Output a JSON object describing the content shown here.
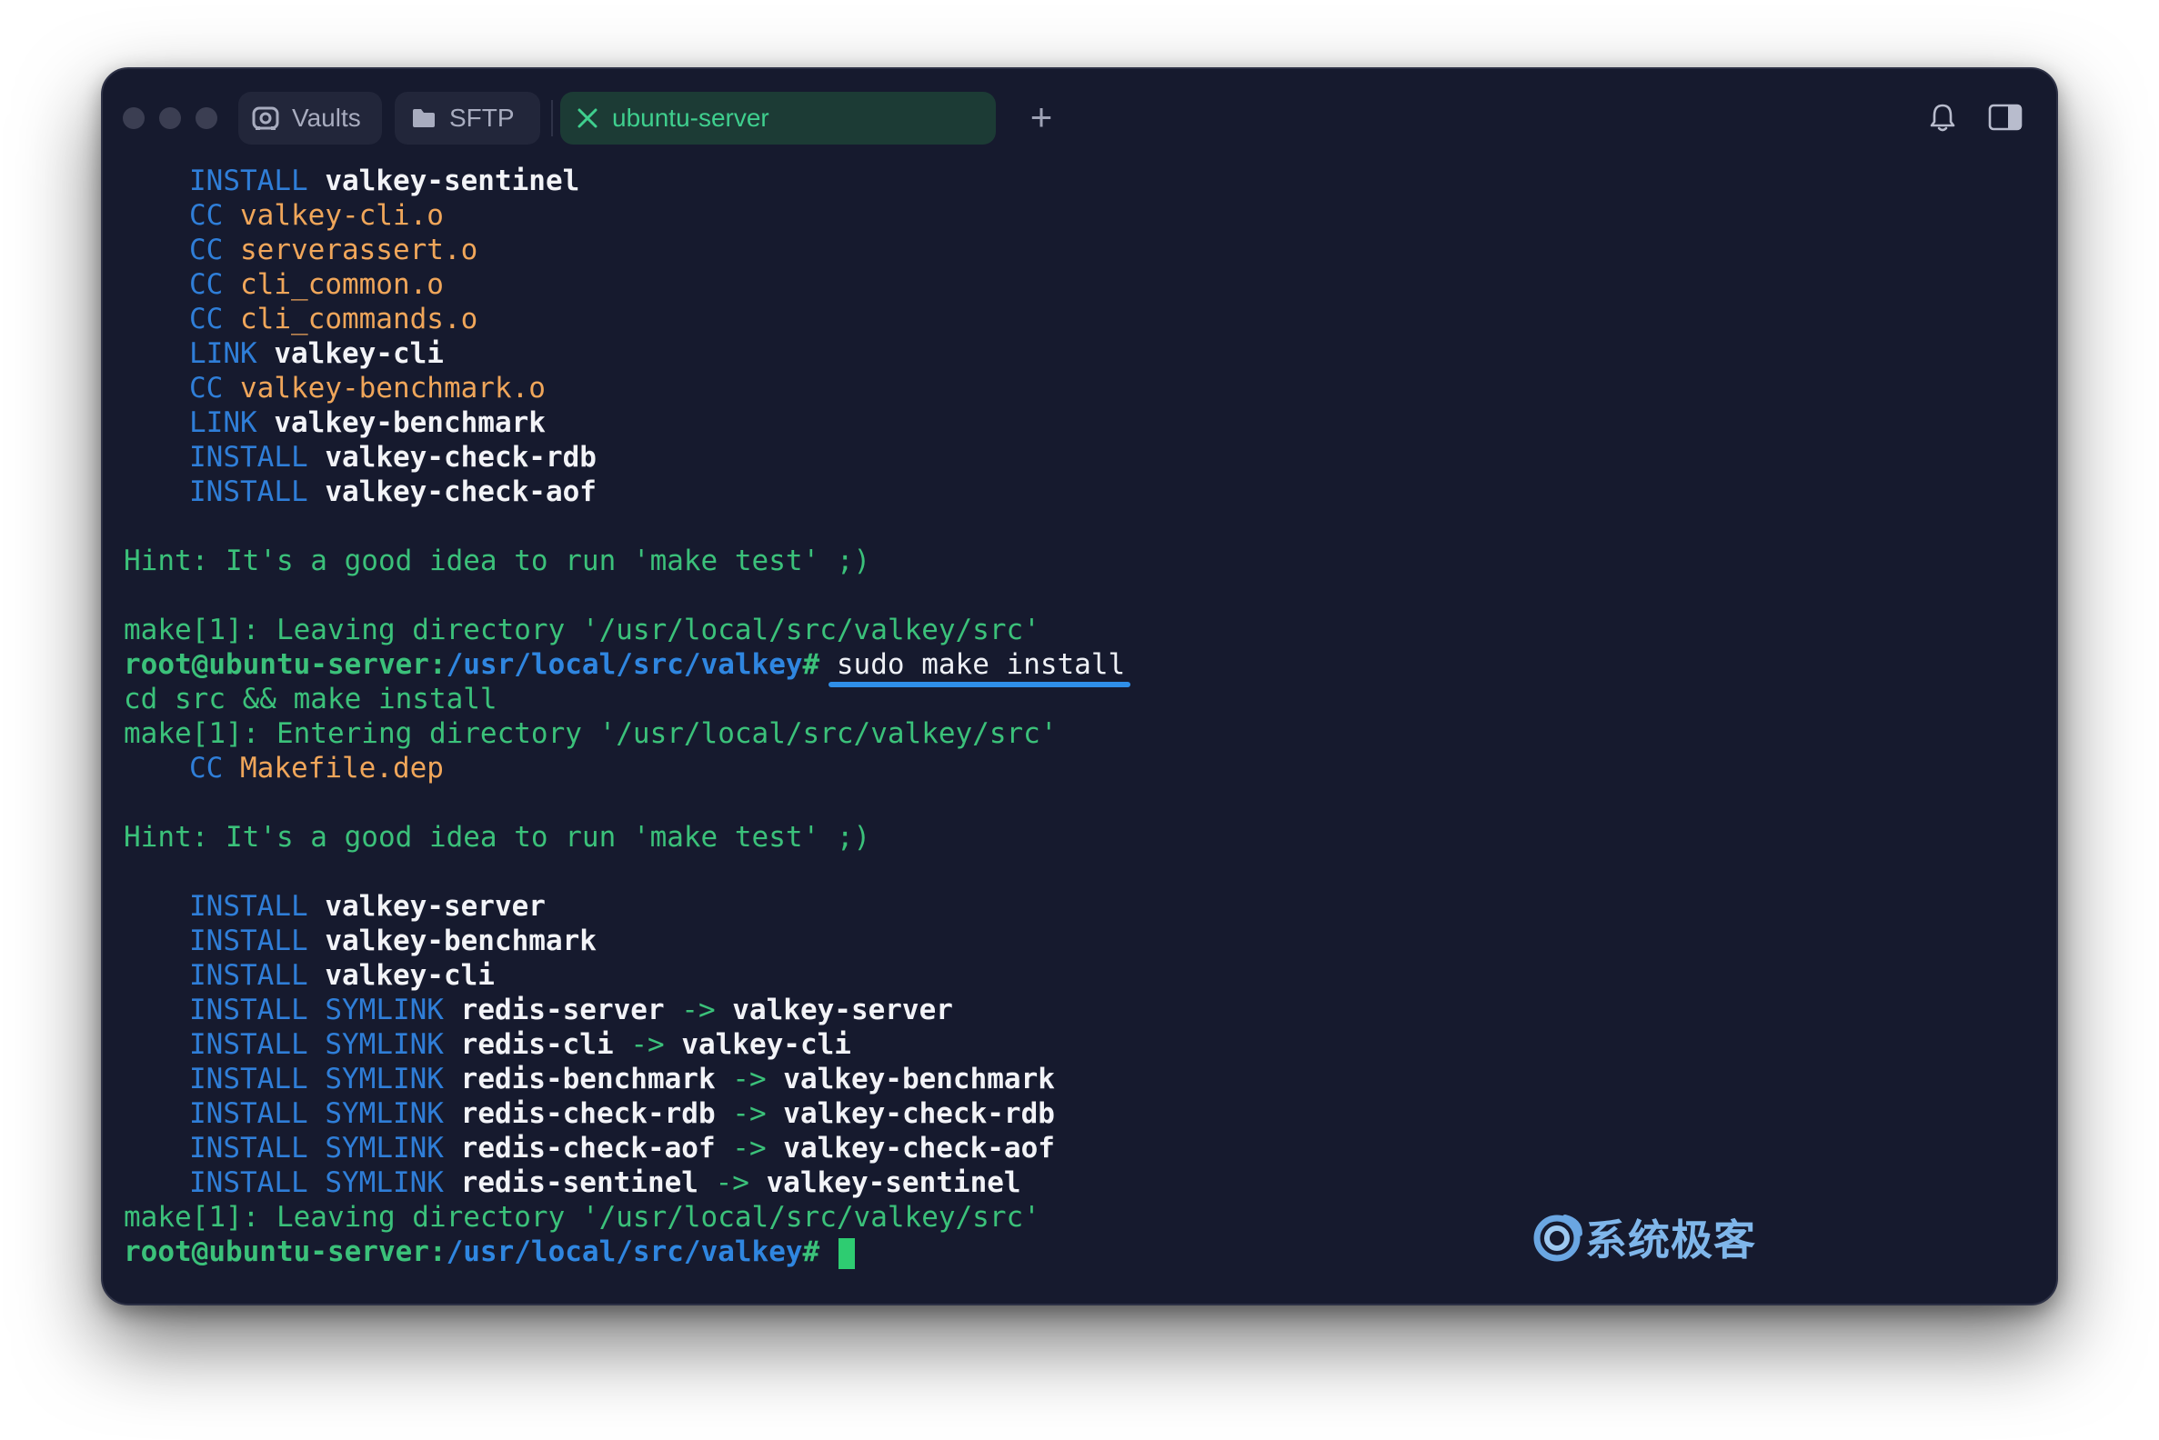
{
  "window": {
    "tabs": [
      {
        "label": "Vaults",
        "icon": "vault-icon",
        "active": false
      },
      {
        "label": "SFTP",
        "icon": "folder-icon",
        "active": false
      },
      {
        "label": "ubuntu-server",
        "icon": "close-icon",
        "active": true
      }
    ],
    "new_tab_label": "+"
  },
  "terminal": {
    "build1": [
      {
        "tag": "INSTALL",
        "name": "valkey-sentinel",
        "kind": "install"
      },
      {
        "tag": "CC",
        "name": "valkey-cli.o",
        "kind": "cc"
      },
      {
        "tag": "CC",
        "name": "serverassert.o",
        "kind": "cc"
      },
      {
        "tag": "CC",
        "name": "cli_common.o",
        "kind": "cc"
      },
      {
        "tag": "CC",
        "name": "cli_commands.o",
        "kind": "cc"
      },
      {
        "tag": "LINK",
        "name": "valkey-cli",
        "kind": "link"
      },
      {
        "tag": "CC",
        "name": "valkey-benchmark.o",
        "kind": "cc"
      },
      {
        "tag": "LINK",
        "name": "valkey-benchmark",
        "kind": "link"
      },
      {
        "tag": "INSTALL",
        "name": "valkey-check-rdb",
        "kind": "install"
      },
      {
        "tag": "INSTALL",
        "name": "valkey-check-aof",
        "kind": "install"
      }
    ],
    "hint": "Hint: It's a good idea to run 'make test' ;)",
    "leaving": "make[1]: Leaving directory '/usr/local/src/valkey/src'",
    "prompt_user": "root@ubuntu-server:",
    "prompt_path": "/usr/local/src/valkey",
    "prompt_suffix": "#",
    "command": "sudo make install",
    "cd_line": "cd src && make install",
    "entering": "make[1]: Entering directory '/usr/local/src/valkey/src'",
    "cc_tag": "CC",
    "makefile_dep": "Makefile.dep",
    "installs": [
      {
        "tag": "INSTALL",
        "name": "valkey-server"
      },
      {
        "tag": "INSTALL",
        "name": "valkey-benchmark"
      },
      {
        "tag": "INSTALL",
        "name": "valkey-cli"
      }
    ],
    "symlinks": [
      {
        "tag": "INSTALL",
        "sym": "SYMLINK",
        "from": "redis-server",
        "arrow": "->",
        "to": "valkey-server"
      },
      {
        "tag": "INSTALL",
        "sym": "SYMLINK",
        "from": "redis-cli",
        "arrow": "->",
        "to": "valkey-cli"
      },
      {
        "tag": "INSTALL",
        "sym": "SYMLINK",
        "from": "redis-benchmark",
        "arrow": "->",
        "to": "valkey-benchmark"
      },
      {
        "tag": "INSTALL",
        "sym": "SYMLINK",
        "from": "redis-check-rdb",
        "arrow": "->",
        "to": "valkey-check-rdb"
      },
      {
        "tag": "INSTALL",
        "sym": "SYMLINK",
        "from": "redis-check-aof",
        "arrow": "->",
        "to": "valkey-check-aof"
      },
      {
        "tag": "INSTALL",
        "sym": "SYMLINK",
        "from": "redis-sentinel",
        "arrow": "->",
        "to": "valkey-sentinel"
      }
    ]
  },
  "watermark": {
    "text": "系统极客"
  },
  "colors": {
    "background": "#161a2e",
    "keyword_blue": "#2f7ed8",
    "orange": "#f0a65a",
    "green": "#3bc17a",
    "active_tab": "#1c3b35",
    "cursor": "#2ecc71",
    "underline": "#2f8fe8"
  }
}
